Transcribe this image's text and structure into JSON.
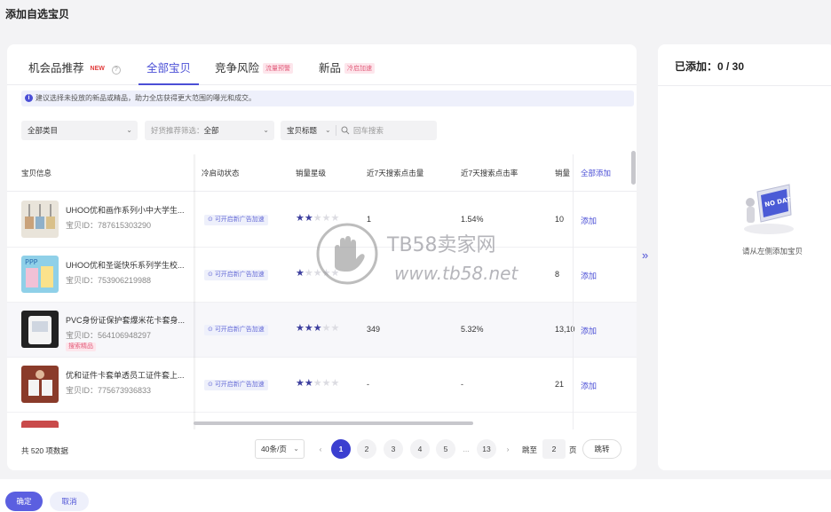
{
  "page_title": "添加自选宝贝",
  "tabs": [
    {
      "label": "机会品推荐",
      "tag": "NEW",
      "active": false
    },
    {
      "label": "全部宝贝",
      "tag": "",
      "active": true
    },
    {
      "label": "竞争风险",
      "tag": "流量预警",
      "active": false
    },
    {
      "label": "新品",
      "tag": "冷启加速",
      "active": false
    }
  ],
  "notice": "建议选择未投放的新品或精品，助力全店获得更大范围的曝光和成交。",
  "filters": {
    "category": "全部类目",
    "recommend_label": "好货推荐筛选：",
    "recommend_value": "全部",
    "search_type": "宝贝标题",
    "search_placeholder": "回车搜索"
  },
  "columns": [
    "宝贝信息",
    "冷启动状态",
    "销量星级",
    "近7天搜索点击量",
    "近7天搜索点击率",
    "销量",
    "全部添加"
  ],
  "rows": [
    {
      "name": "UHOO优和画作系列小中大学生...",
      "id": "宝贝ID：787615303290",
      "tag": "",
      "cold": "可开启新广告加速",
      "stars": 2,
      "clicks": "1",
      "ctr": "1.54%",
      "sales": "10",
      "action": "添加"
    },
    {
      "name": "UHOO优和圣诞快乐系列学生校...",
      "id": "宝贝ID：753906219988",
      "tag": "",
      "cold": "可开启新广告加速",
      "stars": 1,
      "clicks": "",
      "ctr": "",
      "sales": "8",
      "action": "添加"
    },
    {
      "name": "PVC身份证保护套爆米花卡套身...",
      "id": "宝贝ID：564106948297",
      "tag": "搜索精品",
      "cold": "可开启新广告加速",
      "stars": 3,
      "clicks": "349",
      "ctr": "5.32%",
      "sales": "13,10",
      "action": "添加"
    },
    {
      "name": "优和证件卡套单透员工证件套上...",
      "id": "宝贝ID：775673936833",
      "tag": "",
      "cold": "可开启新广告加速",
      "stars": 2,
      "clicks": "-",
      "ctr": "-",
      "sales": "21",
      "action": "添加"
    }
  ],
  "pagination": {
    "total": "共 520 项数据",
    "page_size": "40条/页",
    "pages": [
      "1",
      "2",
      "3",
      "4",
      "5",
      "...",
      "13"
    ],
    "current": "1",
    "goto_label": "跳至",
    "goto_value": "2",
    "page_unit": "页",
    "goto_button": "跳转"
  },
  "right_panel": {
    "added": "已添加：0 / 30",
    "empty_text": "请从左侧添加宝贝",
    "nodata_label": "NO DATA"
  },
  "watermark": {
    "brand": "TB58卖家网",
    "url": "www.tb58.net"
  },
  "buttons": {
    "ok": "确定",
    "cancel": "取消"
  },
  "colors": {
    "accent": "#4b4fd6",
    "primary_button": "#5b5fe0",
    "tag_pink": "#e25c7a"
  }
}
